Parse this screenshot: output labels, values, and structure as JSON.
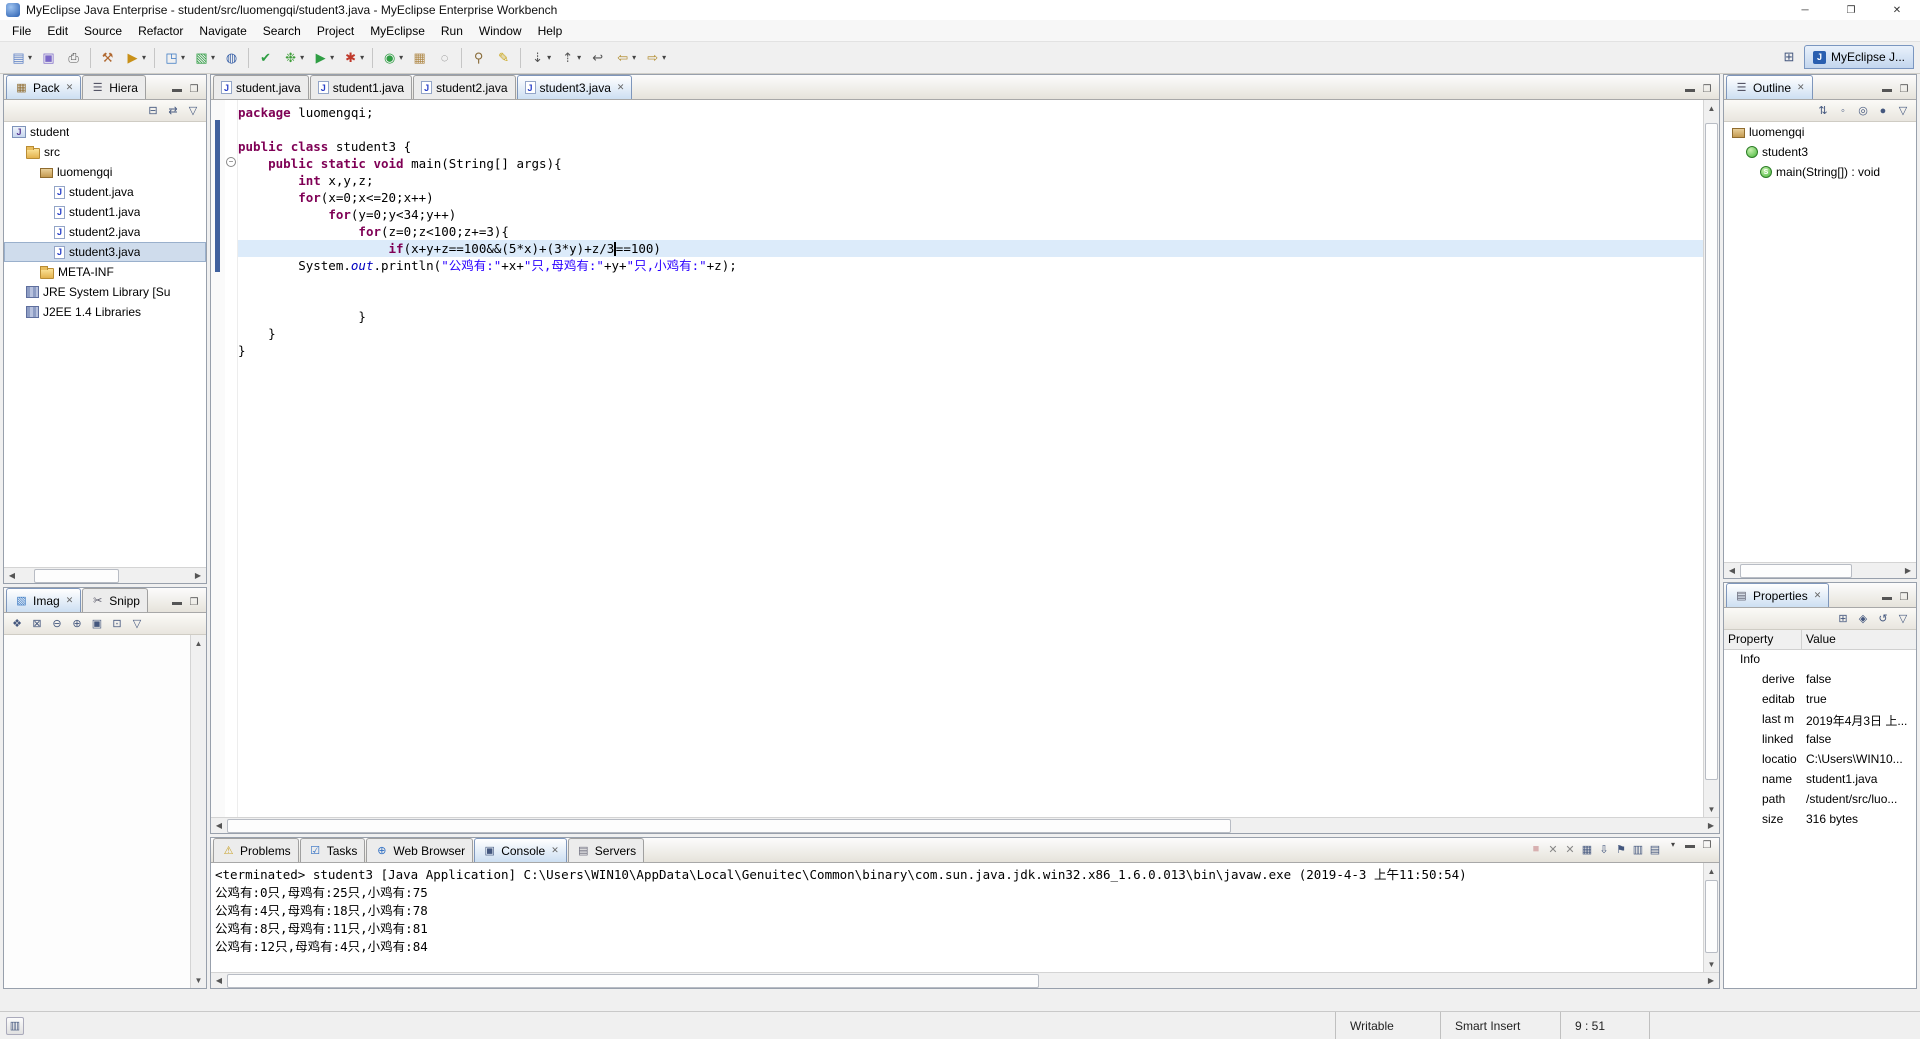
{
  "window": {
    "title": "MyEclipse Java Enterprise - student/src/luomengqi/student3.java - MyEclipse Enterprise Workbench",
    "controls": [
      {
        "name": "minimize",
        "glyph": "─"
      },
      {
        "name": "restore",
        "glyph": "❐"
      },
      {
        "name": "close",
        "glyph": "✕"
      }
    ]
  },
  "menubar": [
    "File",
    "Edit",
    "Source",
    "Refactor",
    "Navigate",
    "Search",
    "Project",
    "MyEclipse",
    "Run",
    "Window",
    "Help"
  ],
  "toolbar": [
    {
      "name": "new-wizard",
      "glyph": "▤",
      "color": "#5b7fc4",
      "dd": true
    },
    {
      "name": "save",
      "glyph": "▣",
      "color": "#7b68c8"
    },
    {
      "name": "print",
      "glyph": "⎙",
      "color": "#555"
    },
    "|",
    {
      "name": "deploy-project",
      "glyph": "⚒",
      "color": "#b06830"
    },
    {
      "name": "run-server",
      "glyph": "▶",
      "color": "#c89018",
      "dd": true
    },
    "|",
    {
      "name": "new-web-project",
      "glyph": "◳",
      "color": "#3a78c2",
      "dd": true
    },
    {
      "name": "new-report",
      "glyph": "▧",
      "color": "#2f9e44",
      "dd": true
    },
    {
      "name": "database-explorer",
      "glyph": "◍",
      "color": "#3a62a8"
    },
    "|",
    {
      "name": "validate",
      "glyph": "✔",
      "color": "#2f9e44"
    },
    {
      "name": "debug",
      "glyph": "❉",
      "color": "#3f9e3a",
      "dd": true
    },
    {
      "name": "run",
      "glyph": "▶",
      "color": "#2f9e44",
      "dd": true
    },
    {
      "name": "external-tools",
      "glyph": "✱",
      "color": "#c0392b",
      "dd": true
    },
    "|",
    {
      "name": "new-java-class",
      "glyph": "◉",
      "color": "#2f9e44",
      "dd": true
    },
    {
      "name": "new-java-package",
      "glyph": "▦",
      "color": "#b08a4a"
    },
    {
      "name": "open-type",
      "glyph": "◌",
      "color": "#777"
    },
    "|",
    {
      "name": "search",
      "glyph": "⚲",
      "color": "#8a6d3b"
    },
    {
      "name": "mark-occurrences",
      "glyph": "✎",
      "color": "#c8a415"
    },
    "|",
    {
      "name": "next-annotation",
      "glyph": "⇣",
      "color": "#555",
      "dd": true
    },
    {
      "name": "previous-annotation",
      "glyph": "⇡",
      "color": "#555",
      "dd": true
    },
    {
      "name": "last-edit-location",
      "glyph": "↩",
      "color": "#555"
    },
    {
      "name": "back",
      "glyph": "⇦",
      "color": "#b08a2a",
      "dd": true
    },
    {
      "name": "forward",
      "glyph": "⇨",
      "color": "#b08a2a",
      "dd": true
    }
  ],
  "perspective": {
    "active_label": "MyEclipse J..."
  },
  "package_explorer": {
    "tabs": [
      {
        "label": "Pack",
        "icon": "pe",
        "active": true
      },
      {
        "label": "Hiera",
        "icon": "hierarchy"
      }
    ],
    "tools": [
      {
        "name": "collapse-all",
        "glyph": "⊟"
      },
      {
        "name": "link-with-editor",
        "glyph": "⇄"
      },
      {
        "name": "view-menu",
        "glyph": "▽"
      }
    ],
    "tree": [
      {
        "label": "student",
        "icon": "project",
        "depth": 0
      },
      {
        "label": "src",
        "icon": "src",
        "depth": 1
      },
      {
        "label": "luomengqi",
        "icon": "package",
        "depth": 2
      },
      {
        "label": "student.java",
        "icon": "jfile",
        "depth": 3
      },
      {
        "label": "student1.java",
        "icon": "jfile",
        "depth": 3
      },
      {
        "label": "student2.java",
        "icon": "jfile",
        "depth": 3
      },
      {
        "label": "student3.java",
        "icon": "jfile",
        "depth": 3,
        "selected": true
      },
      {
        "label": "META-INF",
        "icon": "folder",
        "depth": 2
      },
      {
        "label": "JRE System Library [Su",
        "icon": "library",
        "depth": 1
      },
      {
        "label": "J2EE 1.4 Libraries",
        "icon": "library",
        "depth": 1
      }
    ]
  },
  "image_view": {
    "tabs": [
      {
        "label": "Imag",
        "icon": "image",
        "active": true
      },
      {
        "label": "Snipp",
        "icon": "snippet"
      }
    ],
    "tools": [
      {
        "name": "pan",
        "glyph": "❖"
      },
      {
        "name": "select",
        "glyph": "⊠"
      },
      {
        "name": "zoom-out",
        "glyph": "⊖"
      },
      {
        "name": "zoom-in",
        "glyph": "⊕"
      },
      {
        "name": "zoom-100",
        "glyph": "▣"
      },
      {
        "name": "fit-to-window",
        "glyph": "⊡"
      },
      {
        "name": "view-menu",
        "glyph": "▽"
      }
    ]
  },
  "editor": {
    "tabs": [
      {
        "label": "student.java",
        "icon": "jfile"
      },
      {
        "label": "student1.java",
        "icon": "jfile"
      },
      {
        "label": "student2.java",
        "icon": "jfile"
      },
      {
        "label": "student3.java",
        "icon": "jfile",
        "active": true
      }
    ],
    "current_line": 9,
    "code": [
      [
        [
          "kw",
          "package"
        ],
        [
          "pl",
          " luomengqi;"
        ]
      ],
      [],
      [
        [
          "kw",
          "public"
        ],
        [
          "pl",
          " "
        ],
        [
          "kw",
          "class"
        ],
        [
          "pl",
          " student3 {"
        ]
      ],
      [
        [
          "pl",
          "    "
        ],
        [
          "kw",
          "public"
        ],
        [
          "pl",
          " "
        ],
        [
          "kw",
          "static"
        ],
        [
          "pl",
          " "
        ],
        [
          "kw",
          "void"
        ],
        [
          "pl",
          " main(String[] args){"
        ]
      ],
      [
        [
          "pl",
          "        "
        ],
        [
          "kw",
          "int"
        ],
        [
          "pl",
          " x,y,z;"
        ]
      ],
      [
        [
          "pl",
          "        "
        ],
        [
          "kw",
          "for"
        ],
        [
          "pl",
          "(x=0;x<=20;x++)"
        ]
      ],
      [
        [
          "pl",
          "            "
        ],
        [
          "kw",
          "for"
        ],
        [
          "pl",
          "(y=0;y<34;y++)"
        ]
      ],
      [
        [
          "pl",
          "                "
        ],
        [
          "kw",
          "for"
        ],
        [
          "pl",
          "(z=0;z<100;z+=3){"
        ]
      ],
      [
        [
          "pl",
          "                    "
        ],
        [
          "kw",
          "if"
        ],
        [
          "pl",
          "(x+y+z==100&&(5*x)+(3*y)+z/3"
        ],
        [
          "caret",
          ""
        ],
        [
          "pl",
          "==100)"
        ]
      ],
      [
        [
          "pl",
          "        System."
        ],
        [
          "sf",
          "out"
        ],
        [
          "pl",
          ".println("
        ],
        [
          "str",
          "\"公鸡有:\""
        ],
        [
          "pl",
          "+x+"
        ],
        [
          "str",
          "\"只,母鸡有:\""
        ],
        [
          "pl",
          "+y+"
        ],
        [
          "str",
          "\"只,小鸡有:\""
        ],
        [
          "pl",
          "+z);"
        ]
      ],
      [],
      [],
      [
        [
          "pl",
          "                }"
        ]
      ],
      [
        [
          "pl",
          "    }"
        ]
      ],
      [
        [
          "pl",
          "}"
        ]
      ]
    ]
  },
  "outline": {
    "tab": {
      "label": "Outline",
      "icon": "outline"
    },
    "tools": [
      {
        "name": "sort",
        "glyph": "⇅"
      },
      {
        "name": "hide-fields",
        "glyph": "◦"
      },
      {
        "name": "hide-static-members",
        "glyph": "◎"
      },
      {
        "name": "hide-non-public",
        "glyph": "●"
      },
      {
        "name": "view-menu",
        "glyph": "▽"
      }
    ],
    "items": [
      {
        "label": "luomengqi",
        "icon": "package",
        "depth": 0
      },
      {
        "label": "student3",
        "icon": "class",
        "depth": 1
      },
      {
        "label": "main(String[]) : void",
        "icon": "method",
        "depth": 2
      }
    ]
  },
  "console": {
    "tabs": [
      {
        "label": "Problems",
        "icon": "problems"
      },
      {
        "label": "Tasks",
        "icon": "tasks"
      },
      {
        "label": "Web Browser",
        "icon": "web"
      },
      {
        "label": "Console",
        "icon": "console",
        "active": true
      },
      {
        "label": "Servers",
        "icon": "servers"
      }
    ],
    "tools": [
      {
        "name": "terminate",
        "glyph": "■",
        "color": "#d8b0b0"
      },
      {
        "name": "remove-launch",
        "glyph": "✕",
        "color": "#888"
      },
      {
        "name": "remove-all-launches",
        "glyph": "✕",
        "color": "#888"
      },
      {
        "name": "clear-console",
        "glyph": "▦",
        "color": "#44577e"
      },
      {
        "name": "scroll-lock",
        "glyph": "⇩",
        "color": "#44577e"
      },
      {
        "name": "pin-console",
        "glyph": "⚑",
        "color": "#44577e"
      },
      {
        "name": "display-selected-console",
        "glyph": "▥",
        "color": "#44577e"
      },
      {
        "name": "open-console",
        "glyph": "▤",
        "color": "#44577e",
        "dd": true
      }
    ],
    "lines": [
      "<terminated> student3 [Java Application] C:\\Users\\WIN10\\AppData\\Local\\Genuitec\\Common\\binary\\com.sun.java.jdk.win32.x86_1.6.0.013\\bin\\javaw.exe (2019-4-3 上午11:50:54)",
      "公鸡有:0只,母鸡有:25只,小鸡有:75",
      "公鸡有:4只,母鸡有:18只,小鸡有:78",
      "公鸡有:8只,母鸡有:11只,小鸡有:81",
      "公鸡有:12只,母鸡有:4只,小鸡有:84"
    ]
  },
  "properties": {
    "tab": {
      "label": "Properties",
      "icon": "properties"
    },
    "tools": [
      {
        "name": "show-categories",
        "glyph": "⊞"
      },
      {
        "name": "show-advanced",
        "glyph": "◈"
      },
      {
        "name": "restore-defaults",
        "glyph": "↺"
      },
      {
        "name": "view-menu",
        "glyph": "▽"
      }
    ],
    "columns": [
      "Property",
      "Value"
    ],
    "rows": [
      {
        "label": "Info",
        "value": "",
        "group": true
      },
      {
        "label": "derive",
        "value": "false"
      },
      {
        "label": "editab",
        "value": "true"
      },
      {
        "label": "last m",
        "value": "2019年4月3日 上..."
      },
      {
        "label": "linked",
        "value": "false"
      },
      {
        "label": "locatio",
        "value": "C:\\Users\\WIN10..."
      },
      {
        "label": "name",
        "value": "student1.java"
      },
      {
        "label": "path",
        "value": "/student/src/luo..."
      },
      {
        "label": "size",
        "value": "316 bytes"
      }
    ]
  },
  "statusbar": {
    "writable": "Writable",
    "insert_mode": "Smart Insert",
    "cursor_position": "9 : 51"
  }
}
